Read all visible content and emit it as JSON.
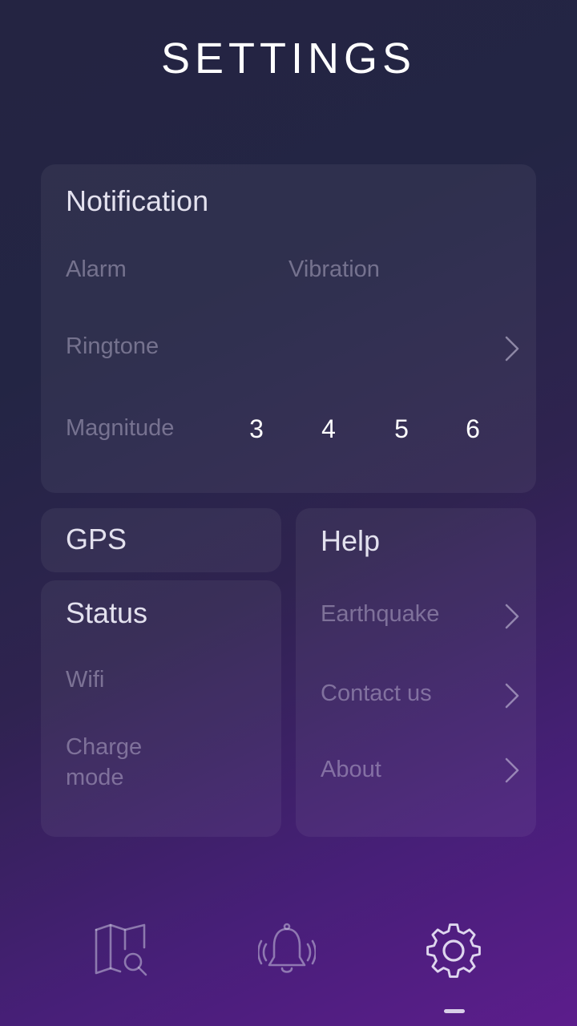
{
  "header": {
    "title": "SETTINGS"
  },
  "notification": {
    "title": "Notification",
    "alarm_label": "Alarm",
    "vibration_label": "Vibration",
    "ringtone_label": "Ringtone",
    "magnitude_label": "Magnitude",
    "magnitude_options": [
      "3",
      "4",
      "5",
      "6"
    ]
  },
  "gps": {
    "title": "GPS"
  },
  "status": {
    "title": "Status",
    "wifi_label": "Wifi",
    "charge_mode_label_line1": "Charge",
    "charge_mode_label_line2": "mode"
  },
  "help": {
    "title": "Help",
    "items": [
      {
        "label": "Earthquake"
      },
      {
        "label": "Contact us"
      },
      {
        "label": "About"
      }
    ]
  },
  "bottom_nav": {
    "items": [
      {
        "icon": "map-search-icon"
      },
      {
        "icon": "bell-ringing-icon"
      },
      {
        "icon": "gear-icon"
      }
    ],
    "active": "gear-icon"
  }
}
